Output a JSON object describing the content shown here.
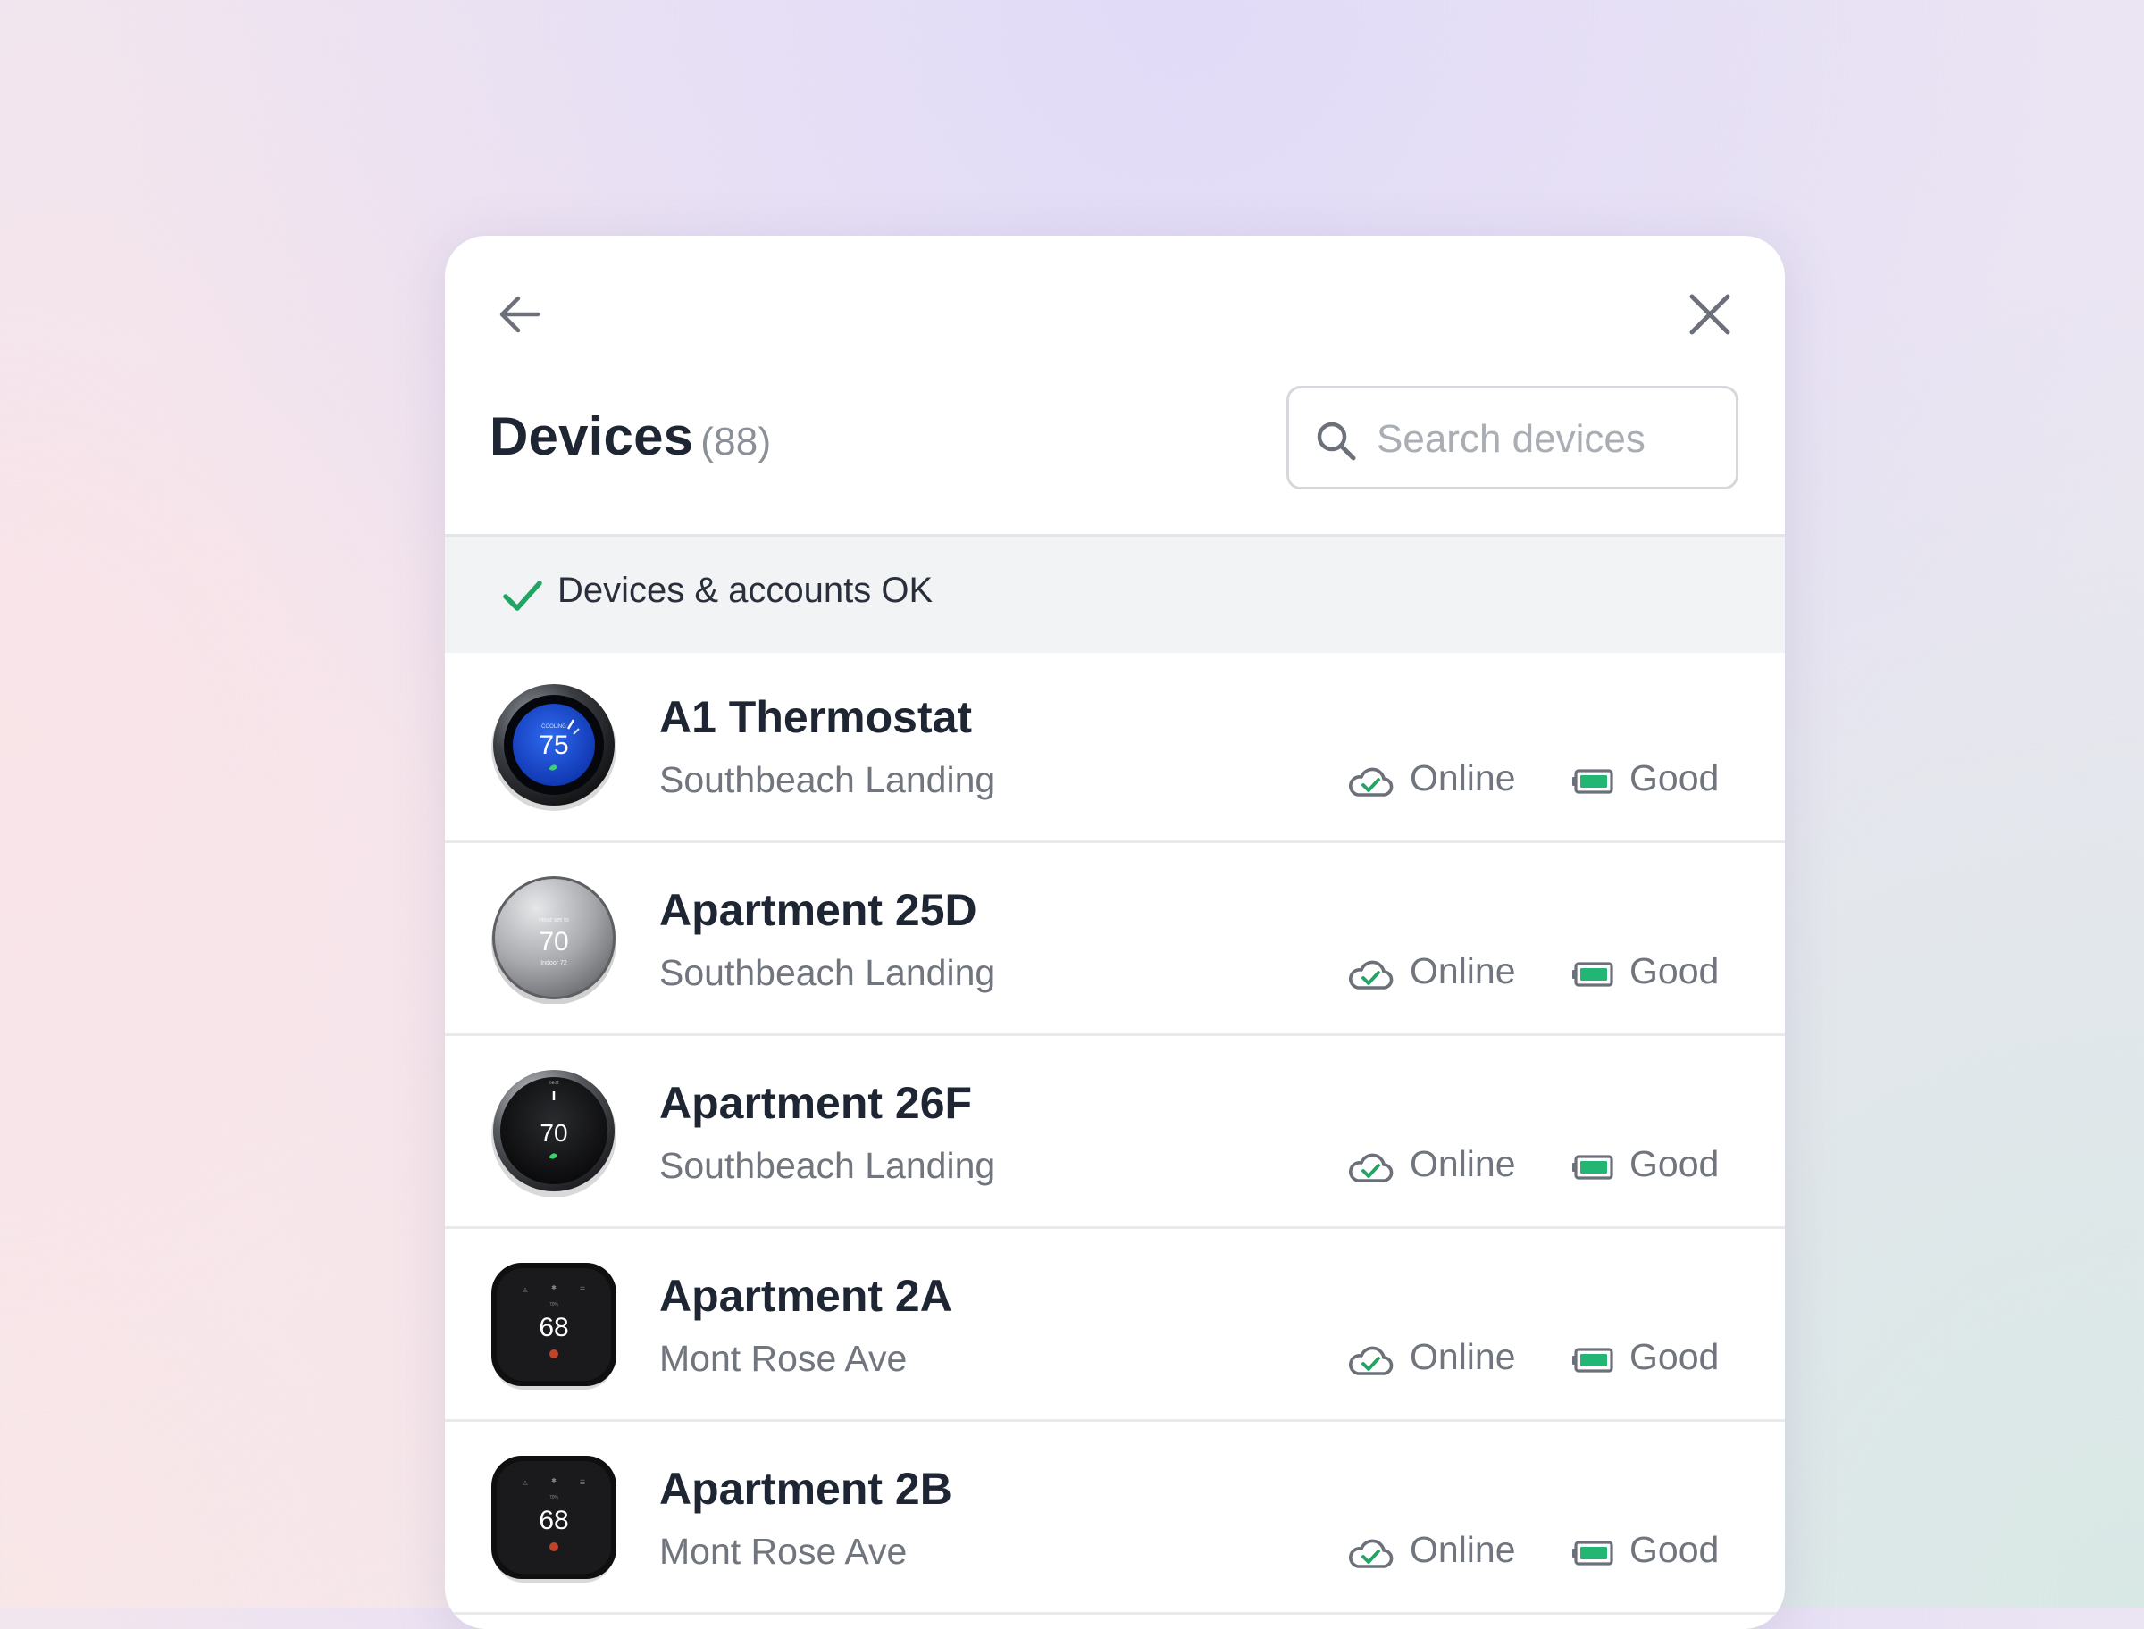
{
  "header": {
    "title": "Devices",
    "count": "(88)",
    "back_icon": "arrow-left-icon",
    "close_icon": "close-icon"
  },
  "search": {
    "placeholder": "Search devices",
    "value": ""
  },
  "status": {
    "icon": "check-icon",
    "text": "Devices & accounts OK",
    "color": "#22a564"
  },
  "colors": {
    "online_check": "#22a564",
    "battery_good": "#22b573",
    "icon_gray": "#6b7079"
  },
  "devices": [
    {
      "name": "A1 Thermostat",
      "location": "Southbeach Landing",
      "connectivity": "Online",
      "battery": "Good",
      "thumbnail": "thermostat-blue-icon",
      "display_temp": "75"
    },
    {
      "name": "Apartment 25D",
      "location": "Southbeach Landing",
      "connectivity": "Online",
      "battery": "Good",
      "thumbnail": "thermostat-silver-icon",
      "display_temp": "70"
    },
    {
      "name": "Apartment 26F",
      "location": "Southbeach Landing",
      "connectivity": "Online",
      "battery": "Good",
      "thumbnail": "thermostat-black-round-icon",
      "display_temp": "70"
    },
    {
      "name": "Apartment 2A",
      "location": "Mont Rose Ave",
      "connectivity": "Online",
      "battery": "Good",
      "thumbnail": "thermostat-square-icon",
      "display_temp": "68"
    },
    {
      "name": "Apartment 2B",
      "location": "Mont Rose Ave",
      "connectivity": "Online",
      "battery": "Good",
      "thumbnail": "thermostat-square-icon",
      "display_temp": "68"
    }
  ]
}
